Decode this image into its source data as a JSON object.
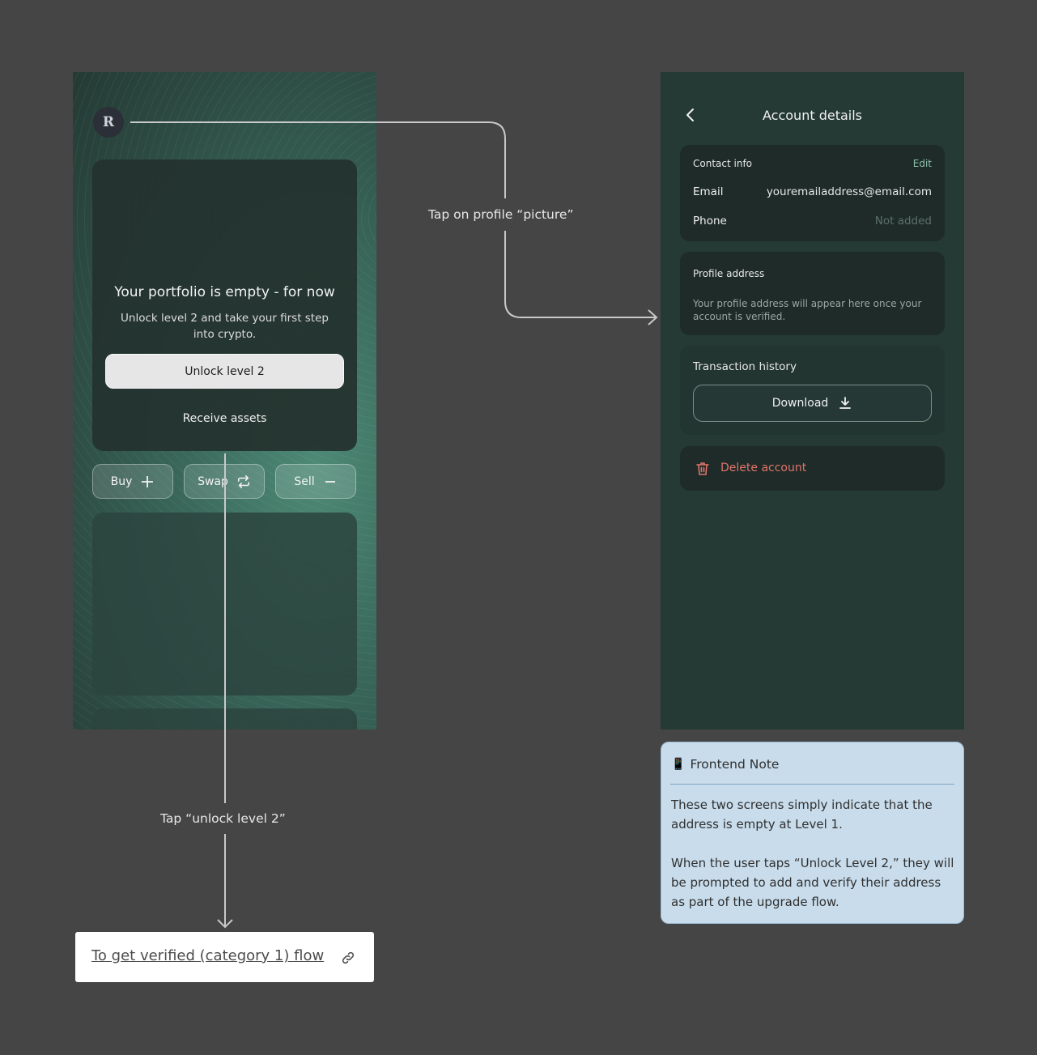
{
  "home_screen": {
    "avatar_letter": "R",
    "portfolio": {
      "title": "Your portfolio is empty - for now",
      "subtitle": "Unlock level 2 and take your first step into crypto.",
      "unlock_button": "Unlock level 2",
      "receive_button": "Receive assets"
    },
    "actions": [
      {
        "label": "Buy",
        "icon": "plus-icon"
      },
      {
        "label": "Swap",
        "icon": "swap-icon"
      },
      {
        "label": "Sell",
        "icon": "minus-icon"
      }
    ]
  },
  "account_screen": {
    "title": "Account details",
    "contact": {
      "section_label": "Contact info",
      "edit_label": "Edit",
      "email_label": "Email",
      "email_value": "youremailaddress@email.com",
      "phone_label": "Phone",
      "phone_value": "Not added"
    },
    "address": {
      "section_label": "Profile address",
      "text": "Your profile address will appear here once your account is verified."
    },
    "transactions": {
      "section_label": "Transaction history",
      "download_label": "Download"
    },
    "delete_label": "Delete account"
  },
  "annotations": {
    "profile_tap": "Tap on profile “picture”",
    "unlock_tap": "Tap “unlock level 2”"
  },
  "flow_link": {
    "label": "To get verified (category 1) flow"
  },
  "note": {
    "icon": "📱",
    "title": "Frontend Note",
    "paragraph_1": "These two screens simply indicate that the address is empty at Level 1.",
    "paragraph_2": "When the user taps “Unlock Level 2,” they will be prompted to add and verify their address as part of the upgrade flow."
  },
  "colors": {
    "canvas": "#454545",
    "phone_bg": "#253a34",
    "accent_green": "#8fc1ad",
    "danger": "#e1746a",
    "note_bg": "#c8dceb"
  }
}
